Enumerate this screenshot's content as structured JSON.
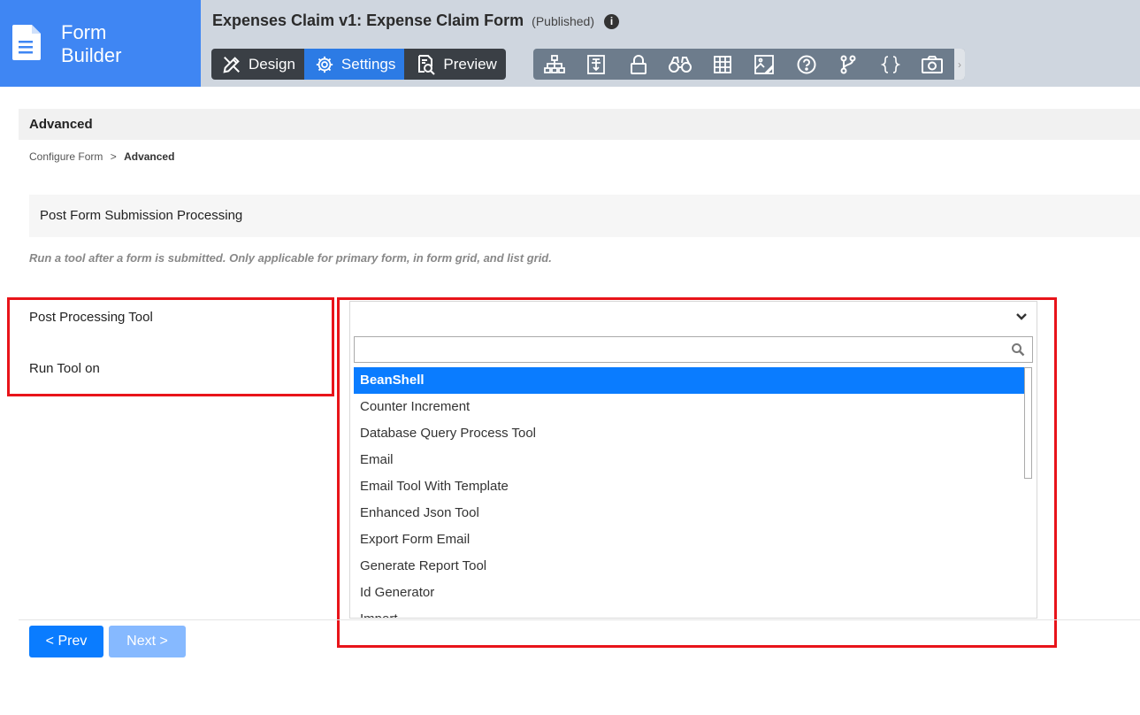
{
  "brand": {
    "line1": "Form",
    "line2": "Builder",
    "icon": "document-icon"
  },
  "header": {
    "title": "Expenses Claim v1: Expense Claim Form",
    "status": "(Published)",
    "info_icon": "i"
  },
  "modes": [
    {
      "label": "Design",
      "icon": "design-tools-icon",
      "active": false
    },
    {
      "label": "Settings",
      "icon": "gear-icon",
      "active": true
    },
    {
      "label": "Preview",
      "icon": "preview-icon",
      "active": false
    }
  ],
  "tools": [
    "hierarchy-icon",
    "form-field-icon",
    "lock-icon",
    "binoculars-icon",
    "grid-icon",
    "image-edit-icon",
    "help-icon",
    "branch-icon",
    "code-braces-icon",
    "camera-icon"
  ],
  "tools_more": "›",
  "section": {
    "title": "Advanced"
  },
  "breadcrumb": {
    "parent": "Configure Form",
    "sep": ">",
    "current": "Advanced"
  },
  "subsection": {
    "title": "Post Form Submission Processing",
    "description": "Run a tool after a form is submitted. Only applicable for primary form, in form grid, and list grid."
  },
  "fields": {
    "post_tool_label": "Post Processing Tool",
    "run_on_label": "Run Tool on"
  },
  "dropdown": {
    "selected": "",
    "search_value": "",
    "options": [
      "BeanShell",
      "Counter Increment",
      "Database Query Process Tool",
      "Email",
      "Email Tool With Template",
      "Enhanced Json Tool",
      "Export Form Email",
      "Generate Report Tool",
      "Id Generator",
      "Import"
    ],
    "highlighted_index": 0
  },
  "nav": {
    "prev": "< Prev",
    "next": "Next >"
  },
  "colors": {
    "brand": "#3f86f3",
    "accent": "#0a7cff",
    "highlight_box": "#e8141a",
    "topbar": "#cfd6df"
  }
}
